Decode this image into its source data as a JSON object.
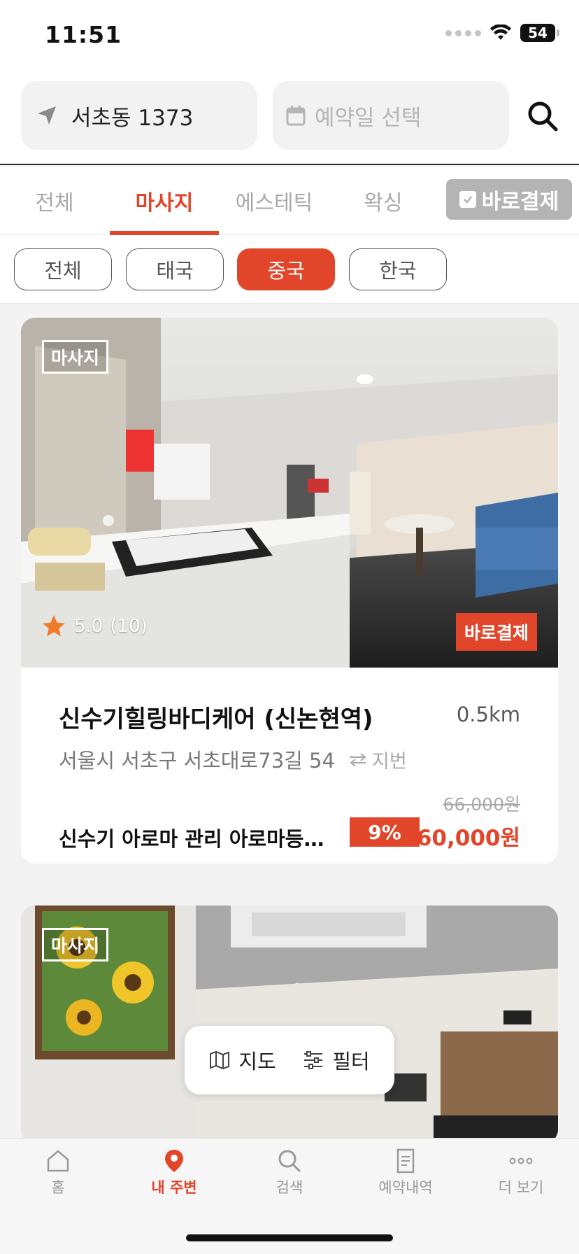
{
  "status": {
    "time": "11:51",
    "battery": "54"
  },
  "search": {
    "location": "서초동 1373",
    "date_placeholder": "예약일 선택"
  },
  "categories": [
    {
      "label": "전체"
    },
    {
      "label": "마사지"
    },
    {
      "label": "에스테틱"
    },
    {
      "label": "왁싱"
    }
  ],
  "instant_pay_label": "바로결제",
  "subfilters": [
    {
      "label": "전체"
    },
    {
      "label": "태국"
    },
    {
      "label": "중국"
    },
    {
      "label": "한국"
    }
  ],
  "listings": [
    {
      "tag": "마사지",
      "rating": "5.0",
      "review_count": "(10)",
      "instant_badge": "바로결제",
      "name": "신수기힐링바디케어 (신논현역)",
      "distance": "0.5km",
      "address": "서울시 서초구 서초대로73길 54",
      "jibun_label": "지번",
      "service": "신수기 아로마 관리  아로마등…",
      "original_price": "66,000원",
      "discount": "9%",
      "price": "60,000원"
    },
    {
      "tag": "마사지"
    }
  ],
  "float": {
    "map_label": "지도",
    "filter_label": "필터"
  },
  "nav": [
    {
      "label": "홈",
      "icon": "home-icon"
    },
    {
      "label": "내 주변",
      "icon": "location-pin-icon"
    },
    {
      "label": "검색",
      "icon": "search-icon"
    },
    {
      "label": "예약내역",
      "icon": "document-icon"
    },
    {
      "label": "더 보기",
      "icon": "more-icon"
    }
  ],
  "colors": {
    "accent": "#e1452a",
    "inactive": "#a9a9a9"
  }
}
